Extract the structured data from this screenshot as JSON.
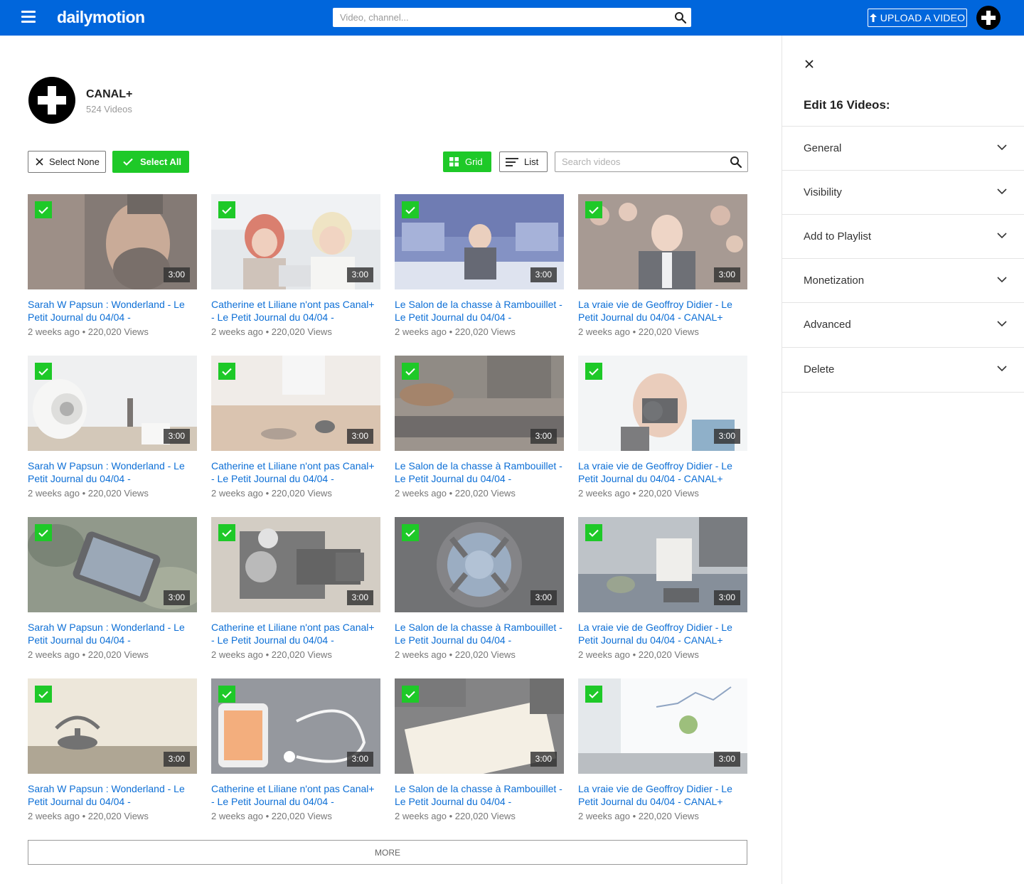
{
  "topbar": {
    "logo": "dailymotion",
    "search_placeholder": "Video, channel...",
    "upload_label": "UPLOAD A VIDEO",
    "brand_color": "#0066dc"
  },
  "channel": {
    "name": "CANAL+",
    "count": "524 Videos"
  },
  "toolbar": {
    "select_none": "Select None",
    "select_all": "Select All",
    "grid": "Grid",
    "list": "List",
    "search_placeholder": "Search videos",
    "accent_color": "#1ec928"
  },
  "videos": [
    {
      "title": "Sarah W Papsun : Wonderland - Le Petit Journal du 04/04 -",
      "meta": "2 weeks ago • 220,020 Views",
      "duration": "3:00",
      "selected": true
    },
    {
      "title": "Catherine et Liliane n'ont pas Canal+ - Le Petit Journal du 04/04 -",
      "meta": "2 weeks ago • 220,020 Views",
      "duration": "3:00",
      "selected": true
    },
    {
      "title": "Le Salon de la chasse à Rambouillet - Le Petit Journal du 04/04 -",
      "meta": "2 weeks ago • 220,020 Views",
      "duration": "3:00",
      "selected": true
    },
    {
      "title": "La vraie vie de Geoffroy Didier - Le Petit Journal du 04/04 - CANAL+",
      "meta": "2 weeks ago • 220,020 Views",
      "duration": "3:00",
      "selected": true
    },
    {
      "title": "Sarah W Papsun : Wonderland - Le Petit Journal du 04/04 -",
      "meta": "2 weeks ago • 220,020 Views",
      "duration": "3:00",
      "selected": true
    },
    {
      "title": "Catherine et Liliane n'ont pas Canal+ - Le Petit Journal du 04/04 -",
      "meta": "2 weeks ago • 220,020 Views",
      "duration": "3:00",
      "selected": true
    },
    {
      "title": "Le Salon de la chasse à Rambouillet - Le Petit Journal du 04/04 -",
      "meta": "2 weeks ago • 220,020 Views",
      "duration": "3:00",
      "selected": true
    },
    {
      "title": "La vraie vie de Geoffroy Didier - Le Petit Journal du 04/04 - CANAL+",
      "meta": "2 weeks ago • 220,020 Views",
      "duration": "3:00",
      "selected": true
    },
    {
      "title": "Sarah W Papsun : Wonderland - Le Petit Journal du 04/04 -",
      "meta": "2 weeks ago • 220,020 Views",
      "duration": "3:00",
      "selected": true
    },
    {
      "title": "Catherine et Liliane n'ont pas Canal+ - Le Petit Journal du 04/04 -",
      "meta": "2 weeks ago • 220,020 Views",
      "duration": "3:00",
      "selected": true
    },
    {
      "title": "Le Salon de la chasse à Rambouillet - Le Petit Journal du 04/04 -",
      "meta": "2 weeks ago • 220,020 Views",
      "duration": "3:00",
      "selected": true
    },
    {
      "title": "La vraie vie de Geoffroy Didier - Le Petit Journal du 04/04 - CANAL+",
      "meta": "2 weeks ago • 220,020 Views",
      "duration": "3:00",
      "selected": true
    },
    {
      "title": "Sarah W Papsun : Wonderland - Le Petit Journal du 04/04 -",
      "meta": "2 weeks ago • 220,020 Views",
      "duration": "3:00",
      "selected": true
    },
    {
      "title": "Catherine et Liliane n'ont pas Canal+ - Le Petit Journal du 04/04 -",
      "meta": "2 weeks ago • 220,020 Views",
      "duration": "3:00",
      "selected": true
    },
    {
      "title": "Le Salon de la chasse à Rambouillet - Le Petit Journal du 04/04 -",
      "meta": "2 weeks ago • 220,020 Views",
      "duration": "3:00",
      "selected": true
    },
    {
      "title": "La vraie vie de Geoffroy Didier - Le Petit Journal du 04/04 - CANAL+",
      "meta": "2 weeks ago • 220,020 Views",
      "duration": "3:00",
      "selected": true
    }
  ],
  "more_label": "MORE",
  "panel": {
    "title": "Edit 16 Videos:",
    "sections": [
      "General",
      "Visibility",
      "Add to Playlist",
      "Monetization",
      "Advanced",
      "Delete"
    ]
  }
}
